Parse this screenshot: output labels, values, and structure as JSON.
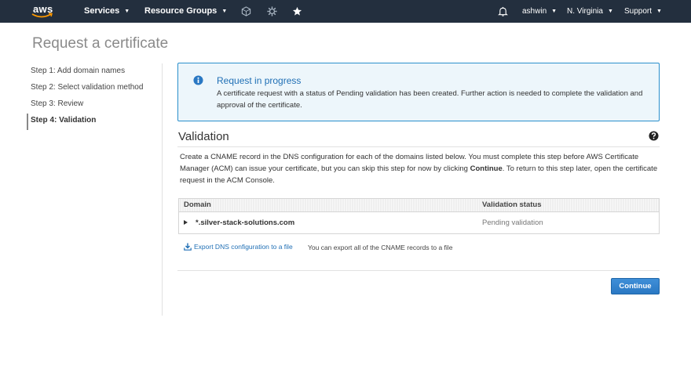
{
  "nav": {
    "logo": "aws",
    "services_label": "Services",
    "resource_groups_label": "Resource Groups",
    "icons": [
      "cube-icon",
      "gear-cog-icon",
      "pin-icon",
      "bell-icon"
    ],
    "user": "ashwin",
    "region": "N. Virginia",
    "support": "Support"
  },
  "page": {
    "title": "Request a certificate"
  },
  "steps": [
    {
      "label": "Step 1: Add domain names",
      "active": false
    },
    {
      "label": "Step 2: Select validation method",
      "active": false
    },
    {
      "label": "Step 3: Review",
      "active": false
    },
    {
      "label": "Step 4: Validation",
      "active": true
    }
  ],
  "info": {
    "title": "Request in progress",
    "text": "A certificate request with a status of Pending validation has been created. Further action is needed to complete the validation and approval of the certificate."
  },
  "validation": {
    "title": "Validation",
    "desc_part1": "Create a CNAME record in the DNS configuration for each of the domains listed below. You must complete this step before AWS Certificate Manager (ACM) can issue your certificate, but you can skip this step for now by clicking ",
    "desc_bold": "Continue",
    "desc_part2": ". To return to this step later, open the certificate request in the ACM Console.",
    "columns": [
      "Domain",
      "Validation status"
    ],
    "rows": [
      {
        "domain": "*.silver-stack-solutions.com",
        "status": "Pending validation"
      }
    ],
    "export_link": "Export DNS configuration to a file",
    "export_note": "You can export all of the CNAME records to a file",
    "continue_label": "Continue"
  },
  "colors": {
    "nav_bg": "#232f3e",
    "info_border": "#2a8fcc",
    "info_bg": "#edf6fb",
    "link": "#1f6fb5",
    "button": "#2a78c3"
  }
}
